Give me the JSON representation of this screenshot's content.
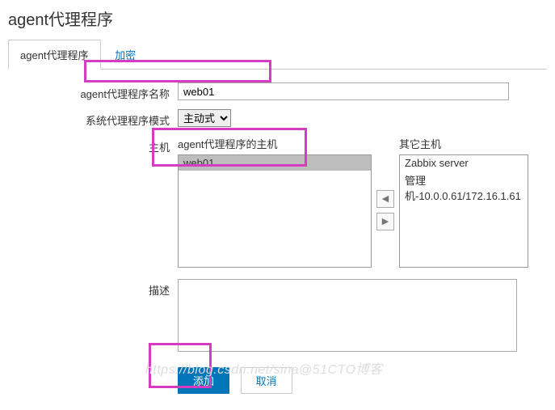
{
  "header": {
    "title": "agent代理程序"
  },
  "tabs": [
    {
      "label": "agent代理程序",
      "active": true
    },
    {
      "label": "加密",
      "active": false
    }
  ],
  "form": {
    "name": {
      "label": "agent代理程序名称",
      "value": "web01"
    },
    "mode": {
      "label": "系统代理程序模式",
      "value": "主动式"
    },
    "hosts": {
      "label": "主机",
      "left_label": "agent代理程序的主机",
      "left_items": [
        "web01"
      ],
      "right_label": "其它主机",
      "right_items": [
        "Zabbix server",
        "管理机-10.0.0.61/172.16.1.61"
      ]
    },
    "description": {
      "label": "描述",
      "value": ""
    }
  },
  "buttons": {
    "add": "添加",
    "cancel": "取消"
  },
  "watermark": "https://blog.csdn.net/sina@51CTO博客",
  "colors": {
    "accent": "#0275b8",
    "highlight": "#d63cc2"
  }
}
